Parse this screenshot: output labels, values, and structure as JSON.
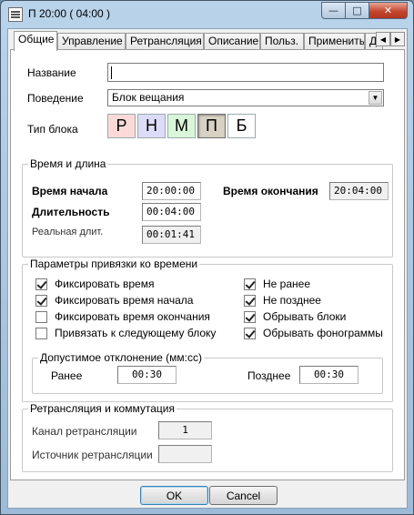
{
  "window": {
    "title": "П 20:00 ( 04:00 )",
    "controls": {
      "minimize": "—",
      "maximize": "□",
      "close": "✕"
    }
  },
  "tabs": [
    {
      "label": "Общие",
      "active": true
    },
    {
      "label": "Управление"
    },
    {
      "label": "Ретрансляция"
    },
    {
      "label": "Описание"
    },
    {
      "label": "Польз."
    },
    {
      "label": "Применить"
    },
    {
      "label": "До"
    }
  ],
  "tab_scroll": {
    "left": "◀",
    "right": "▶"
  },
  "general": {
    "name_label": "Название",
    "name_value": "",
    "behavior_label": "Поведение",
    "behavior_value": "Блок вещания",
    "block_type_label": "Тип блока",
    "block_types": [
      {
        "label": "Р",
        "color": "#fbd9d9"
      },
      {
        "label": "Н",
        "color": "#dcdcf8"
      },
      {
        "label": "М",
        "color": "#d9f6d9"
      },
      {
        "label": "П",
        "color": "#d8d2c4",
        "selected": true
      },
      {
        "label": "Б",
        "color": "#ffffff"
      }
    ]
  },
  "time_group": {
    "title": "Время и длина",
    "start_label": "Время начала",
    "start_value": "20:00:00",
    "end_label": "Время окончания",
    "end_value": "20:04:00",
    "duration_label": "Длительность",
    "duration_value": "00:04:00",
    "real_label": "Реальная длит.",
    "real_value": "00:01:41"
  },
  "binding_group": {
    "title": "Параметры привязки ко времени",
    "left_checks": [
      {
        "label": "Фиксировать время",
        "checked": true
      },
      {
        "label": "Фиксировать время начала",
        "checked": true
      },
      {
        "label": "Фиксировать время окончания",
        "checked": false
      },
      {
        "label": "Привязать к следующему блоку",
        "checked": false
      }
    ],
    "right_checks": [
      {
        "label": "Не ранее",
        "checked": true
      },
      {
        "label": "Не позднее",
        "checked": true
      },
      {
        "label": "Обрывать блоки",
        "checked": true
      },
      {
        "label": "Обрывать фонограммы",
        "checked": true
      }
    ],
    "tolerance": {
      "title": "Допустимое отклонение (мм:сс)",
      "early_label": "Ранее",
      "early_value": "00:30",
      "late_label": "Позднее",
      "late_value": "00:30"
    }
  },
  "relay_group": {
    "title": "Ретрансляция и коммутация",
    "channel_label": "Канал ретрансляции",
    "channel_value": "1",
    "source_label": "Источник ретрансляции",
    "source_value": ""
  },
  "buttons": {
    "ok": "OK",
    "cancel": "Cancel"
  }
}
